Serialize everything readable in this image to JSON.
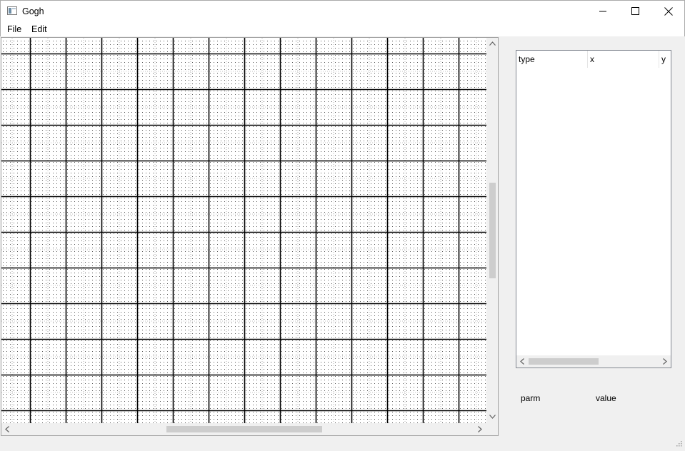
{
  "window": {
    "title": "Gogh"
  },
  "menu": {
    "items": [
      {
        "label": "File"
      },
      {
        "label": "Edit"
      }
    ]
  },
  "list": {
    "columns": [
      {
        "label": "type"
      },
      {
        "label": "x"
      },
      {
        "label": "y"
      }
    ],
    "rows": []
  },
  "properties": {
    "parm_label": "parm",
    "value_label": "value"
  },
  "icons": {
    "app": "app-window-icon",
    "minimize": "minimize-icon",
    "maximize": "maximize-icon",
    "close": "close-icon",
    "scroll_up": "chevron-up-icon",
    "scroll_down": "chevron-down-icon",
    "scroll_left": "chevron-left-icon",
    "scroll_right": "chevron-right-icon",
    "resize": "resize-grip-icon"
  },
  "colors": {
    "grid_line": "#000000",
    "canvas_bg": "#ffffff",
    "window_bg": "#f0f0f0",
    "scroll_thumb": "#cdcdcd"
  }
}
